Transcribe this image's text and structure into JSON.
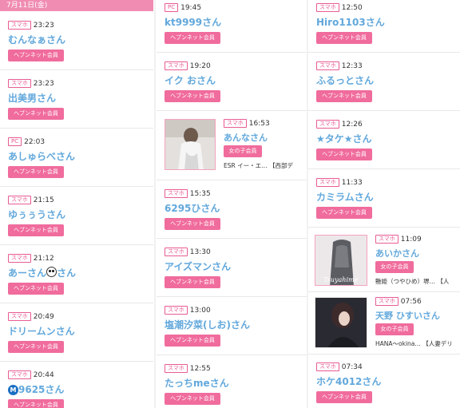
{
  "date_header": "7月11日(金)",
  "badge_smartphone": "スマホ",
  "badge_pc": "PC",
  "tag_hpnet": "ヘブンネット会員",
  "tag_girl": "女の子会員",
  "col1": [
    {
      "device": "スマホ",
      "time": "23:23",
      "name": "むんなぁさん",
      "tag": "ヘブンネット会員"
    },
    {
      "device": "スマホ",
      "time": "23:23",
      "name": "出美男さん",
      "tag": "ヘブンネット会員"
    },
    {
      "device": "PC",
      "time": "22:03",
      "name": "あしゅらべさん",
      "tag": "ヘブンネット会員"
    },
    {
      "device": "スマホ",
      "time": "21:15",
      "name": "ゆぅぅうさん",
      "tag": "ヘブンネット会員"
    },
    {
      "device": "スマホ",
      "time": "21:12",
      "name_pre": "あーさん",
      "name_icon": "panda-icon",
      "name_post": "さん",
      "tag": "ヘブンネット会員"
    },
    {
      "device": "スマホ",
      "time": "20:49",
      "name": "ドリームンさん",
      "tag": "ヘブンネット会員"
    },
    {
      "device": "スマホ",
      "time": "20:44",
      "name_icon": "metro-m-icon",
      "name_post": "9625さん",
      "tag": "ヘブンネット会員"
    }
  ],
  "col2": [
    {
      "device": "PC",
      "time": "19:45",
      "name": "kt9999さん",
      "tag": "ヘブンネット会員"
    },
    {
      "device": "スマホ",
      "time": "19:20",
      "name": "イク おさん",
      "tag": "ヘブンネット会員"
    },
    {
      "device": "スマホ",
      "time": "16:53",
      "name": "あんなさん",
      "tag": "女の子会員",
      "shop": "ESR イー・エ…  【西部デ"
    },
    {
      "device": "スマホ",
      "time": "15:35",
      "name": "6295ひさん",
      "tag": "ヘブンネット会員"
    },
    {
      "device": "スマホ",
      "time": "13:30",
      "name": "アイズマンさん",
      "tag": "ヘブンネット会員"
    },
    {
      "device": "スマホ",
      "time": "13:00",
      "name": "塩潮汐菜(しお)さん",
      "tag": "ヘブンネット会員"
    },
    {
      "device": "スマホ",
      "time": "12:55",
      "name": "たっちmeさん",
      "tag": "ヘブンネット会員"
    }
  ],
  "col3": [
    {
      "device": "スマホ",
      "time": "12:50",
      "name": "Hiro1103さん",
      "tag": "ヘブンネット会員"
    },
    {
      "device": "スマホ",
      "time": "12:33",
      "name": "ふるっとさん",
      "tag": "ヘブンネット会員"
    },
    {
      "device": "スマホ",
      "time": "12:26",
      "name": "★タケ★さん",
      "tag": "ヘブンネット会員"
    },
    {
      "device": "スマホ",
      "time": "11:33",
      "name": "カミラムさん",
      "tag": "ヘブンネット会員"
    },
    {
      "device": "スマホ",
      "time": "11:09",
      "name": "あいかさん",
      "tag": "女の子会員",
      "shop": "艶姫（つやひめ）堺…  【人"
    },
    {
      "device": "スマホ",
      "time": "07:56",
      "name": "天野 ひすいさん",
      "tag": "女の子会員",
      "shop": "HANA～okina…  【人妻デリ"
    },
    {
      "device": "スマホ",
      "time": "07:34",
      "name": "ホケ4012さん",
      "tag": "ヘブンネット会員"
    }
  ],
  "photo_watermark": "Tsuyahime",
  "colors": {
    "pink": "#f06c9c",
    "badge": "#e85b93",
    "name_blue": "#62a8dc",
    "header": "#f08cb1"
  }
}
